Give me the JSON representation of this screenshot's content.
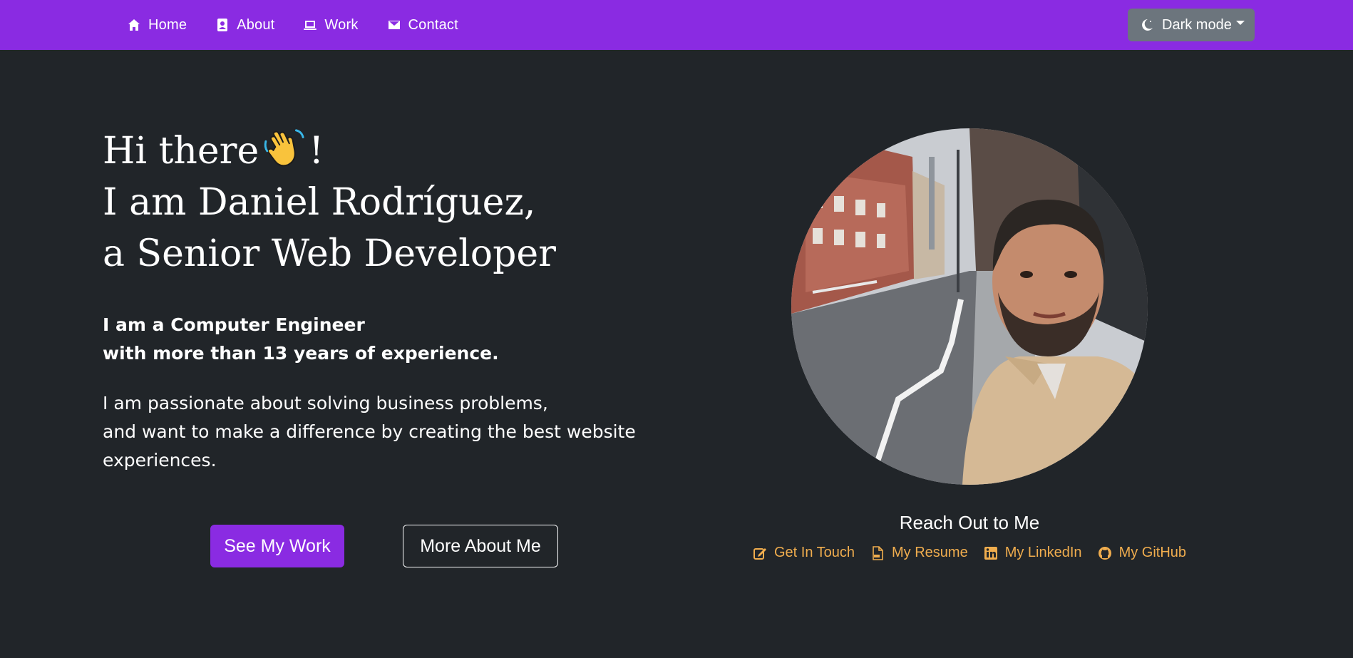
{
  "nav": {
    "items": [
      {
        "label": "Home",
        "icon": "home-icon"
      },
      {
        "label": "About",
        "icon": "contact-card-icon"
      },
      {
        "label": "Work",
        "icon": "laptop-icon"
      },
      {
        "label": "Contact",
        "icon": "envelope-icon"
      }
    ],
    "theme_toggle": {
      "label": "Dark mode",
      "icon": "moon-icon"
    }
  },
  "hero": {
    "line1_prefix": "Hi there",
    "line1_suffix": "!",
    "wave_emoji": "👋",
    "line2": "I am Daniel Rodríguez,",
    "line3": "a Senior Web Developer",
    "intro_line1": "I am a Computer Engineer",
    "intro_line2": "with more than 13 years of experience.",
    "passion_line1": "I am passionate about solving business problems,",
    "passion_line2": "and want to make a difference by creating the best website",
    "passion_line3": "experiences.",
    "primary_button": "See My Work",
    "secondary_button": "More About Me"
  },
  "profile": {
    "reach_title": "Reach Out to Me",
    "links": [
      {
        "label": "Get In Touch",
        "icon": "edit-icon"
      },
      {
        "label": "My Resume",
        "icon": "pdf-file-icon"
      },
      {
        "label": "My LinkedIn",
        "icon": "linkedin-icon"
      },
      {
        "label": "My GitHub",
        "icon": "github-icon"
      }
    ]
  },
  "colors": {
    "brand": "#8a2be2",
    "background": "#212529",
    "toggle": "#6c757d",
    "link": "#f0ad4e"
  }
}
